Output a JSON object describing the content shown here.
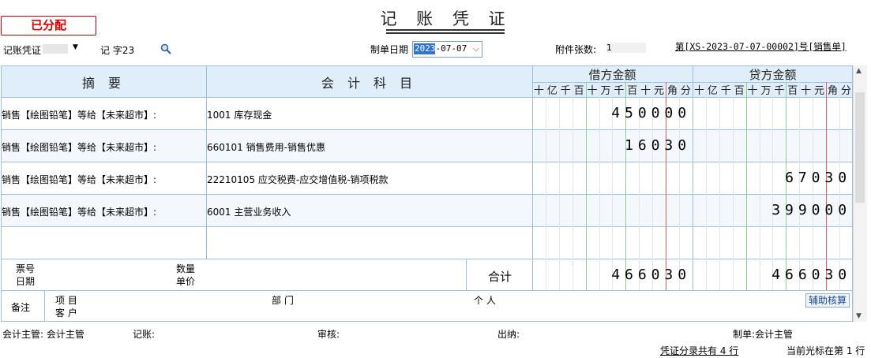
{
  "status_badge": "已分配",
  "title": "记 账 凭 证",
  "voucher_type": {
    "label": "记账凭证"
  },
  "word": "记 字23",
  "date": {
    "label": "制单日期",
    "value_highlight": "2023",
    "value_rest": "-07-07"
  },
  "attachments": {
    "label": "附件张数:",
    "value": "1"
  },
  "voucher_no": "第[XS-2023-07-07-00002]号[销售单]",
  "headers": {
    "summary": "摘 要",
    "account": "会 计 科 目",
    "debit": "借方金额",
    "credit": "贷方金额",
    "digits": [
      "十",
      "亿",
      "千",
      "百",
      "十",
      "万",
      "千",
      "百",
      "十",
      "元",
      "角",
      "分"
    ]
  },
  "rows": [
    {
      "summary": "销售【绘图铅笔】等给【未来超市】:",
      "account": "1001 库存现金",
      "debit": "450000",
      "credit": ""
    },
    {
      "summary": "销售【绘图铅笔】等给【未来超市】:",
      "account": "660101 销售费用-销售优惠",
      "debit": "16030",
      "credit": ""
    },
    {
      "summary": "销售【绘图铅笔】等给【未来超市】:",
      "account": "22210105 应交税费-应交增值税-销项税款",
      "debit": "",
      "credit": "67030"
    },
    {
      "summary": "销售【绘图铅笔】等给【未来超市】:",
      "account": "6001 主营业务收入",
      "debit": "",
      "credit": "399000"
    },
    {
      "summary": "",
      "account": "",
      "debit": "",
      "credit": ""
    }
  ],
  "totals": {
    "ticket_no": "票号",
    "date": "日期",
    "qty": "数量",
    "price": "单价",
    "label": "合计",
    "debit": "466030",
    "credit": "466030"
  },
  "remark": {
    "label": "备注",
    "project": "项 目",
    "customer": "客 户",
    "dept": "部 门",
    "person": "个 人",
    "aux_button": "辅助核算"
  },
  "signatures": {
    "supervisor": "会计主管: 会计主管",
    "bookkeep": "记账:",
    "audit": "审核:",
    "cashier": "出纳:",
    "maker": "制单:会计主管"
  },
  "status_bar": {
    "entries": "凭证分录共有 4 行",
    "cursor": "当前光标在第 1 行"
  }
}
